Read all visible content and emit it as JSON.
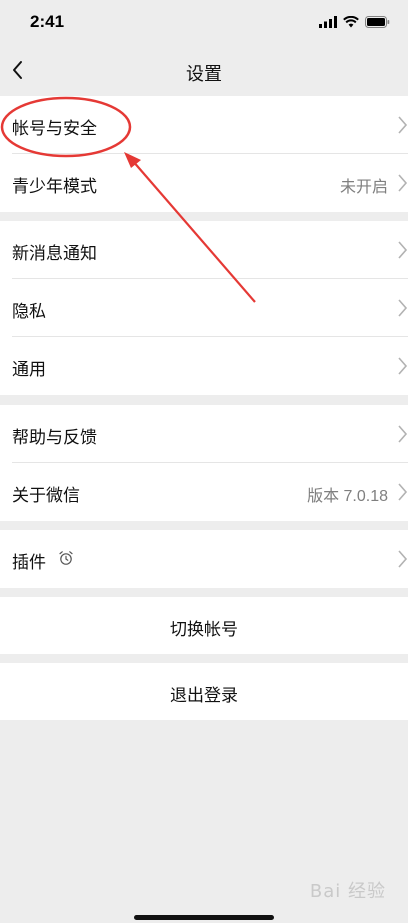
{
  "status": {
    "time": "2:41"
  },
  "nav": {
    "title": "设置"
  },
  "group1": [
    {
      "label": "帐号与安全",
      "value": ""
    },
    {
      "label": "青少年模式",
      "value": "未开启"
    }
  ],
  "group2": [
    {
      "label": "新消息通知",
      "value": ""
    },
    {
      "label": "隐私",
      "value": ""
    },
    {
      "label": "通用",
      "value": ""
    }
  ],
  "group3": [
    {
      "label": "帮助与反馈",
      "value": ""
    },
    {
      "label": "关于微信",
      "value": "版本 7.0.18"
    }
  ],
  "group4": [
    {
      "label": "插件",
      "value": ""
    }
  ],
  "buttons": {
    "switch_account": "切换帐号",
    "logout": "退出登录"
  },
  "watermark": "Bai 经验",
  "colors": {
    "annotation": "#e53935",
    "background": "#ededed",
    "chevron": "#b2b2b2"
  }
}
